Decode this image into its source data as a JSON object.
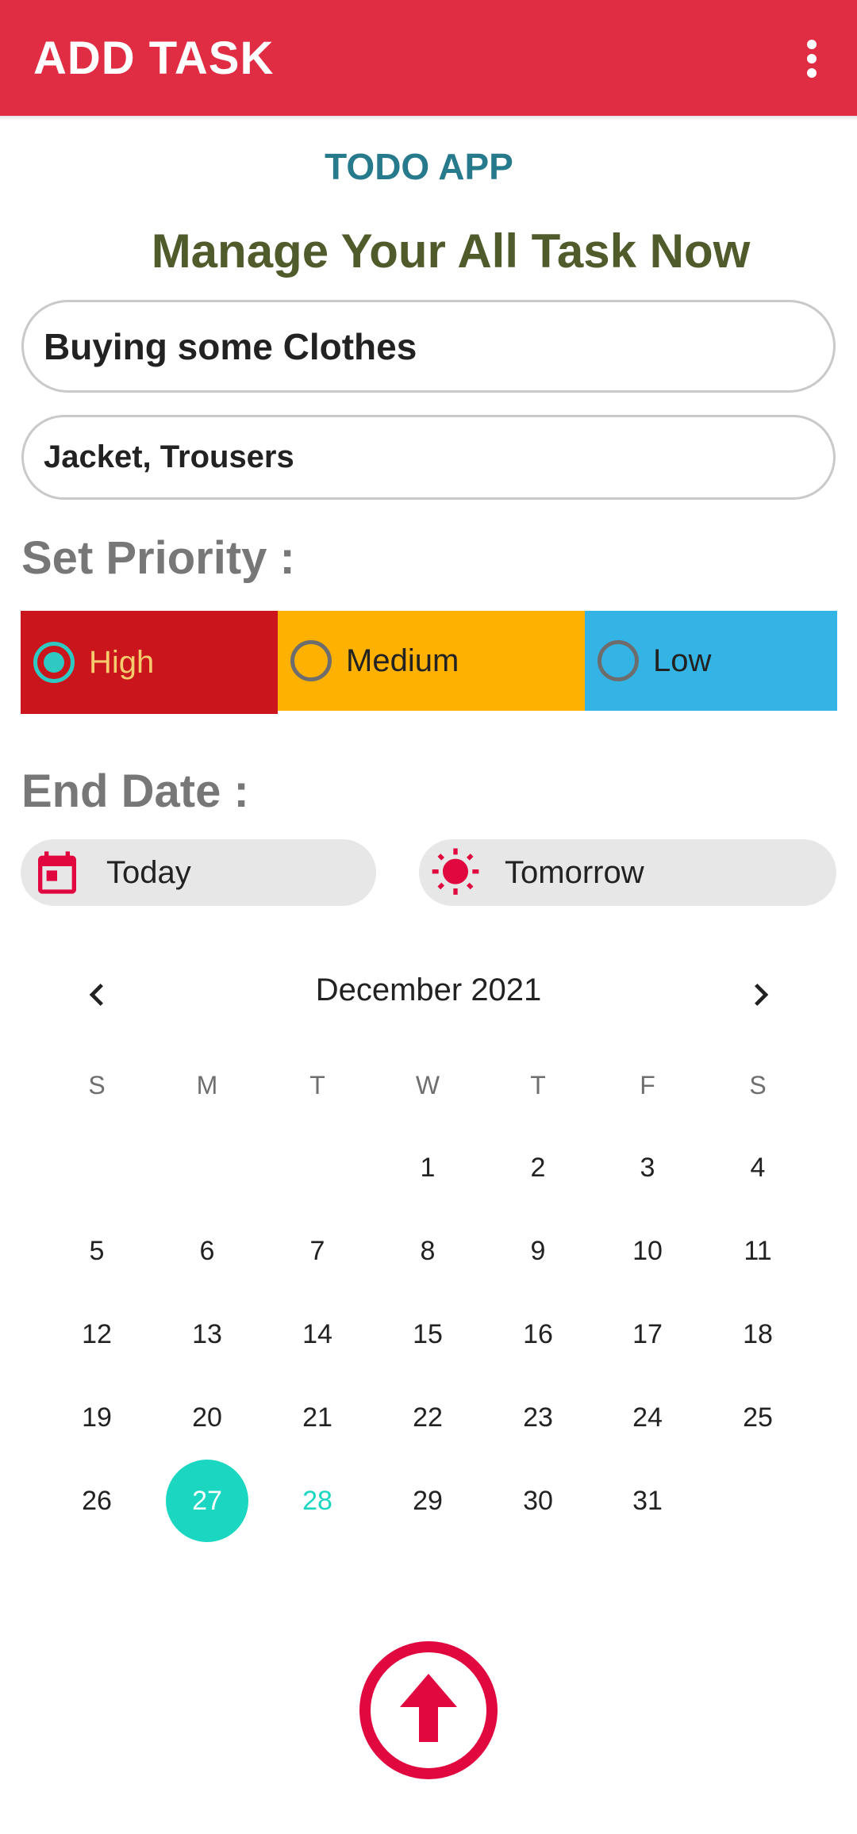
{
  "appbar": {
    "title": "ADD TASK"
  },
  "app_name": "TODO APP",
  "headline": "Manage Your All Task Now",
  "form": {
    "title_value": "Buying some Clothes",
    "description_value": "Jacket, Trousers",
    "priority_label": "Set Priority :",
    "priority_options": [
      "High",
      "Medium",
      "Low"
    ],
    "priority_selected": "High",
    "end_date_label": "End Date :",
    "today_chip": "Today",
    "tomorrow_chip": "Tomorrow"
  },
  "calendar": {
    "month_label": "December 2021",
    "weekdays": [
      "S",
      "M",
      "T",
      "W",
      "T",
      "F",
      "S"
    ],
    "weeks": [
      [
        "",
        "",
        "",
        "1",
        "2",
        "3",
        "4"
      ],
      [
        "5",
        "6",
        "7",
        "8",
        "9",
        "10",
        "11"
      ],
      [
        "12",
        "13",
        "14",
        "15",
        "16",
        "17",
        "18"
      ],
      [
        "19",
        "20",
        "21",
        "22",
        "23",
        "24",
        "25"
      ],
      [
        "26",
        "27",
        "28",
        "29",
        "30",
        "31",
        ""
      ]
    ],
    "selected_day": "27",
    "today_day": "28"
  },
  "colors": {
    "appbar": "#E02D44",
    "accent": "#1BD7C2",
    "high": "#C9151B",
    "medium": "#FEB100",
    "low": "#34B4E5",
    "icon_red": "#E0083F"
  },
  "icons": {
    "overflow": "more-vert-icon",
    "today": "calendar-icon",
    "tomorrow": "sun-icon",
    "prev": "chevron-left-icon",
    "next": "chevron-right-icon",
    "submit": "arrow-up-circle-icon"
  }
}
